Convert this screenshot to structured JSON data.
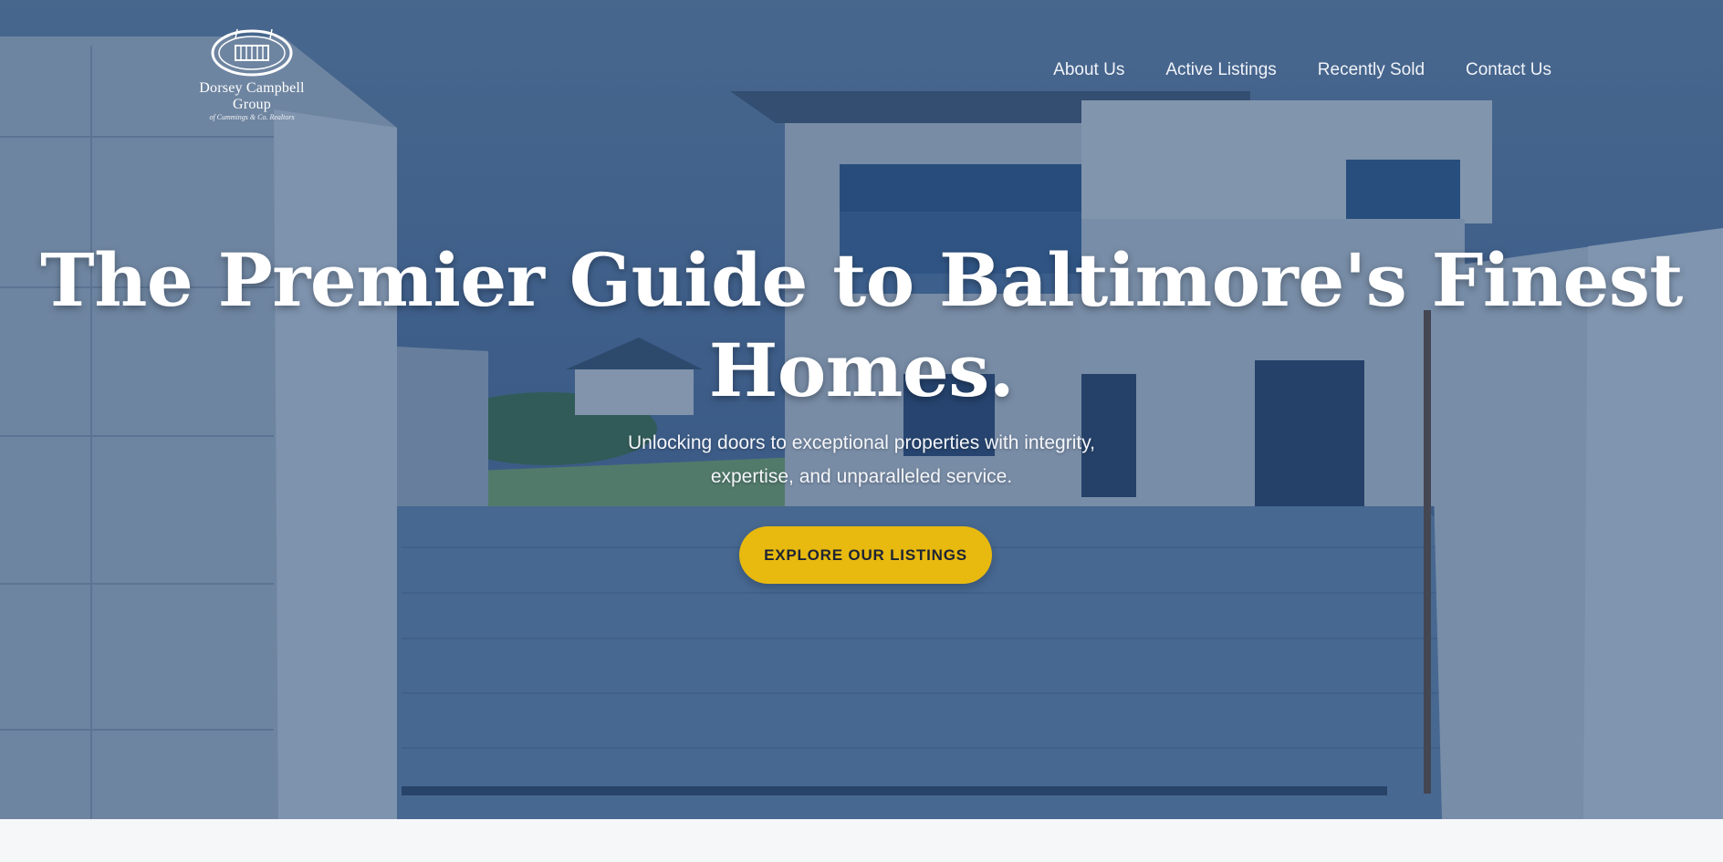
{
  "brand": {
    "name": "Dorsey Campbell Group",
    "tagline": "of Cummings & Co. Realtors"
  },
  "nav": {
    "items": [
      {
        "label": "About Us"
      },
      {
        "label": "Active Listings"
      },
      {
        "label": "Recently Sold"
      },
      {
        "label": "Contact Us"
      }
    ]
  },
  "hero": {
    "headline_line1": "The Premier Guide to Baltimore's Finest",
    "headline_line2": "Homes.",
    "subtitle_line1": "Unlocking doors to exceptional properties with integrity,",
    "subtitle_line2": "expertise, and unparalleled service.",
    "cta_label": "EXPLORE OUR LISTINGS"
  },
  "colors": {
    "accent": "#e8b90f",
    "overlay": "#1e3e6e",
    "text_light": "#ffffff"
  }
}
